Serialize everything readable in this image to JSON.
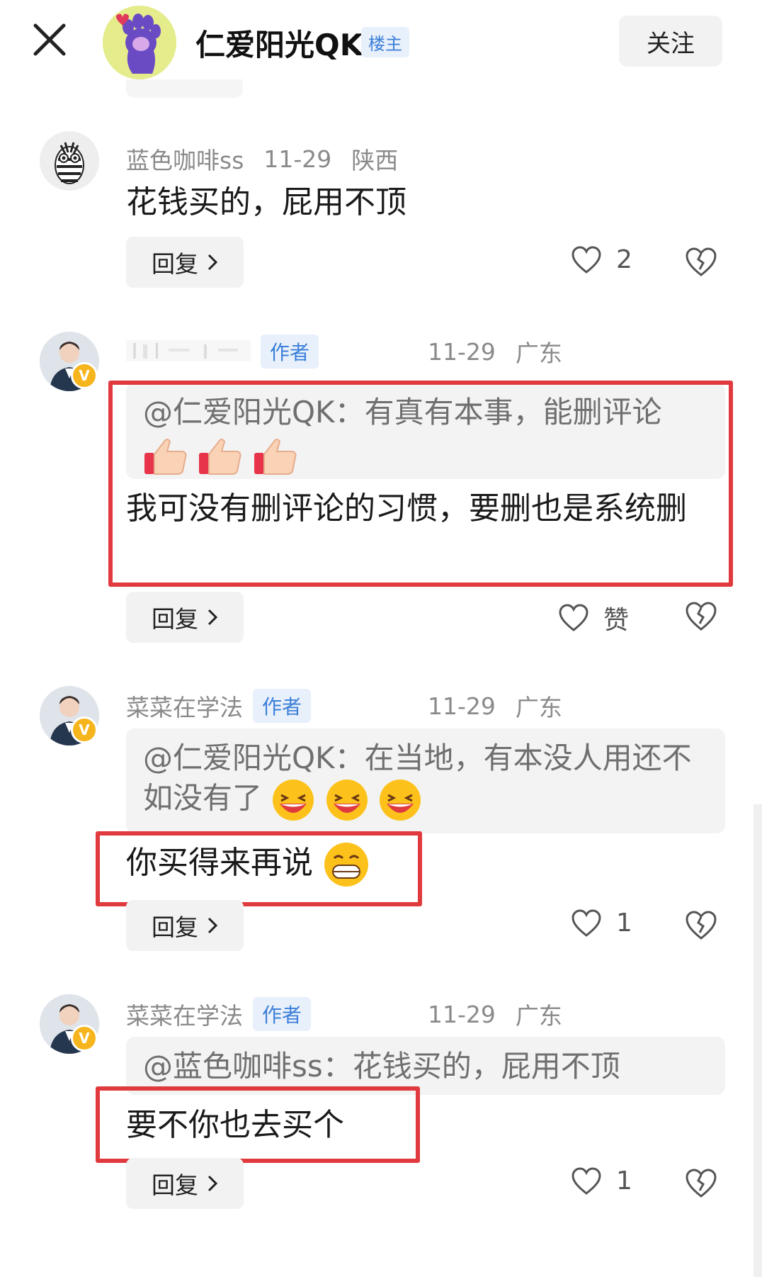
{
  "header": {
    "poster_name": "仁爱阳光QK",
    "owner_badge": "楼主",
    "follow_label": "关注"
  },
  "comments": [
    {
      "user": "蓝色咖啡ss",
      "date": "11-29",
      "location": "陕西",
      "text": "花钱买的，屁用不顶",
      "reply_label": "回复",
      "like_count": "2"
    },
    {
      "user": "",
      "author_tag": "作者",
      "date": "11-29",
      "location": "广东",
      "quote": "@仁爱阳光QK：有真有本事，能删评论",
      "text": "我可没有删评论的习惯，要删也是系统删",
      "reply_label": "回复",
      "like_count": "赞"
    },
    {
      "user": "菜菜在学法",
      "author_tag": "作者",
      "date": "11-29",
      "location": "广东",
      "quote": "@仁爱阳光QK：在当地，有本没人用还不如没有了",
      "text": "你买得来再说",
      "reply_label": "回复",
      "like_count": "1"
    },
    {
      "user": "菜菜在学法",
      "author_tag": "作者",
      "date": "11-29",
      "location": "广东",
      "quote": "@蓝色咖啡ss：花钱买的，屁用不顶",
      "text": "要不你也去买个",
      "reply_label": "回复",
      "like_count": "1"
    }
  ],
  "colors": {
    "highlight_border": "#e03a3e",
    "author_tag": "#3b7fd8",
    "vip_badge": "#f6b51d"
  },
  "icons": {
    "close": "close-icon",
    "like": "heart-icon",
    "dislike": "broken-heart-icon",
    "chevron": "chevron-right-icon",
    "thumbs": "thumbs-up-emoji",
    "laugh": "laughing-emoji",
    "grin": "grinning-emoji"
  }
}
